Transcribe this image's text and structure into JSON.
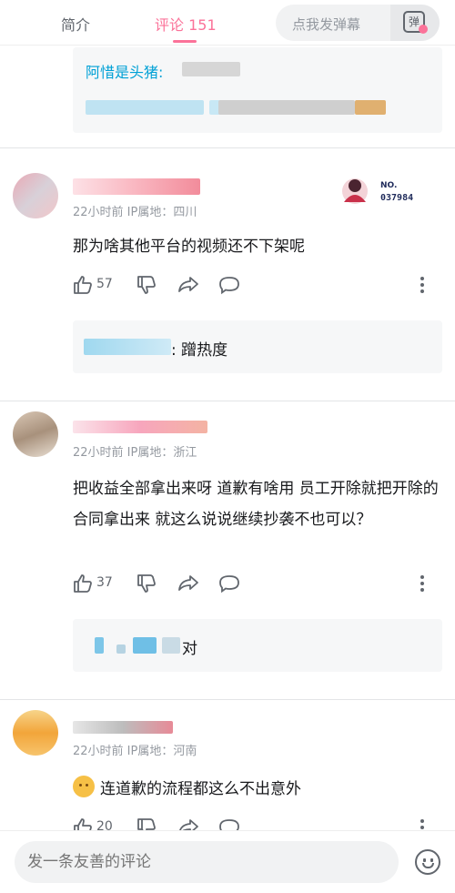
{
  "tabs": {
    "intro": "简介",
    "comments": "评论 151"
  },
  "danmaku": {
    "placeholder": "点我发弹幕",
    "button_icon_text": "弹"
  },
  "top_reply": {
    "name": "阿惜是头猪:"
  },
  "comments": [
    {
      "meta": "22小时前  IP属地：四川",
      "text": "那为啥其他平台的视频还不下架呢",
      "likes": "57",
      "badge": "NO.\n037984",
      "reply": ": 蹭热度"
    },
    {
      "meta": "22小时前  IP属地：浙江",
      "text": "把收益全部拿出来呀 道歉有啥用 员工开除就把开除的合同拿出来 就这么说说继续抄袭不也可以？",
      "likes": "37",
      "reply": "对"
    },
    {
      "meta": "22小时前  IP属地：河南",
      "text": "连道歉的流程都这么不出意外",
      "likes": "20"
    }
  ],
  "bottom": {
    "placeholder": "发一条友善的评论"
  },
  "colors": {
    "accent": "#fb7299",
    "link": "#00a1d6"
  }
}
